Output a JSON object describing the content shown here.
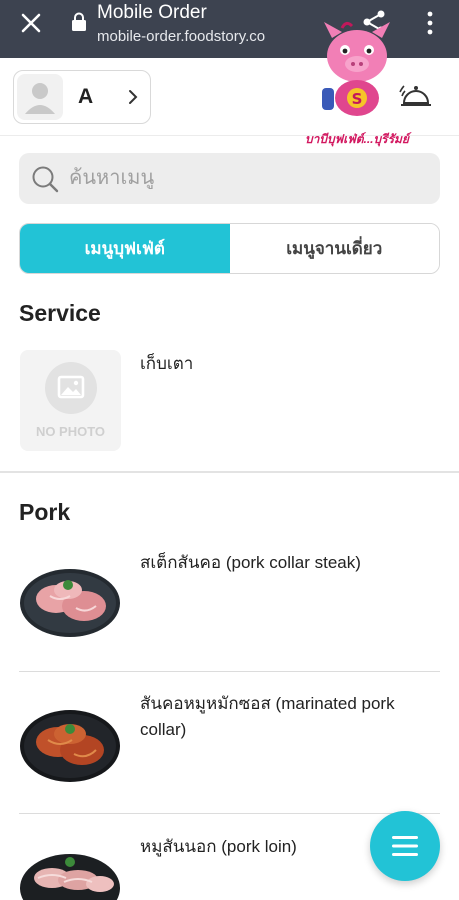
{
  "browser": {
    "title": "Mobile Order",
    "url": "mobile-order.foodstory.co"
  },
  "header": {
    "user_initial": "A",
    "logo_text": "บาบีบุฟเฟ่ต์...บุรีรัมย์",
    "colors": {
      "accent": "#22c3d6"
    }
  },
  "search": {
    "placeholder": "ค้นหาเมนู"
  },
  "tabs": [
    {
      "label": "เมนูบุฟเฟ่ต์",
      "active": true
    },
    {
      "label": "เมนูจานเดี่ยว",
      "active": false
    }
  ],
  "sections": [
    {
      "title": "Service",
      "items": [
        {
          "name": "เก็บเตา",
          "image": "no-photo",
          "no_photo_label": "NO PHOTO"
        }
      ]
    },
    {
      "title": "Pork",
      "items": [
        {
          "name": "สเต็กสันคอ (pork collar steak)",
          "image": "pork-collar-steak"
        },
        {
          "name": "สันคอหมูหมักซอส (marinated pork collar)",
          "image": "marinated-pork-collar"
        },
        {
          "name": "หมูสันนอก (pork loin)",
          "image": "pork-loin"
        }
      ]
    }
  ],
  "icons": {
    "close": "close-icon",
    "lock": "lock-icon",
    "share": "share-icon",
    "more": "more-vert-icon",
    "bell": "service-bell-icon",
    "search": "search-icon",
    "menu": "menu-icon"
  }
}
